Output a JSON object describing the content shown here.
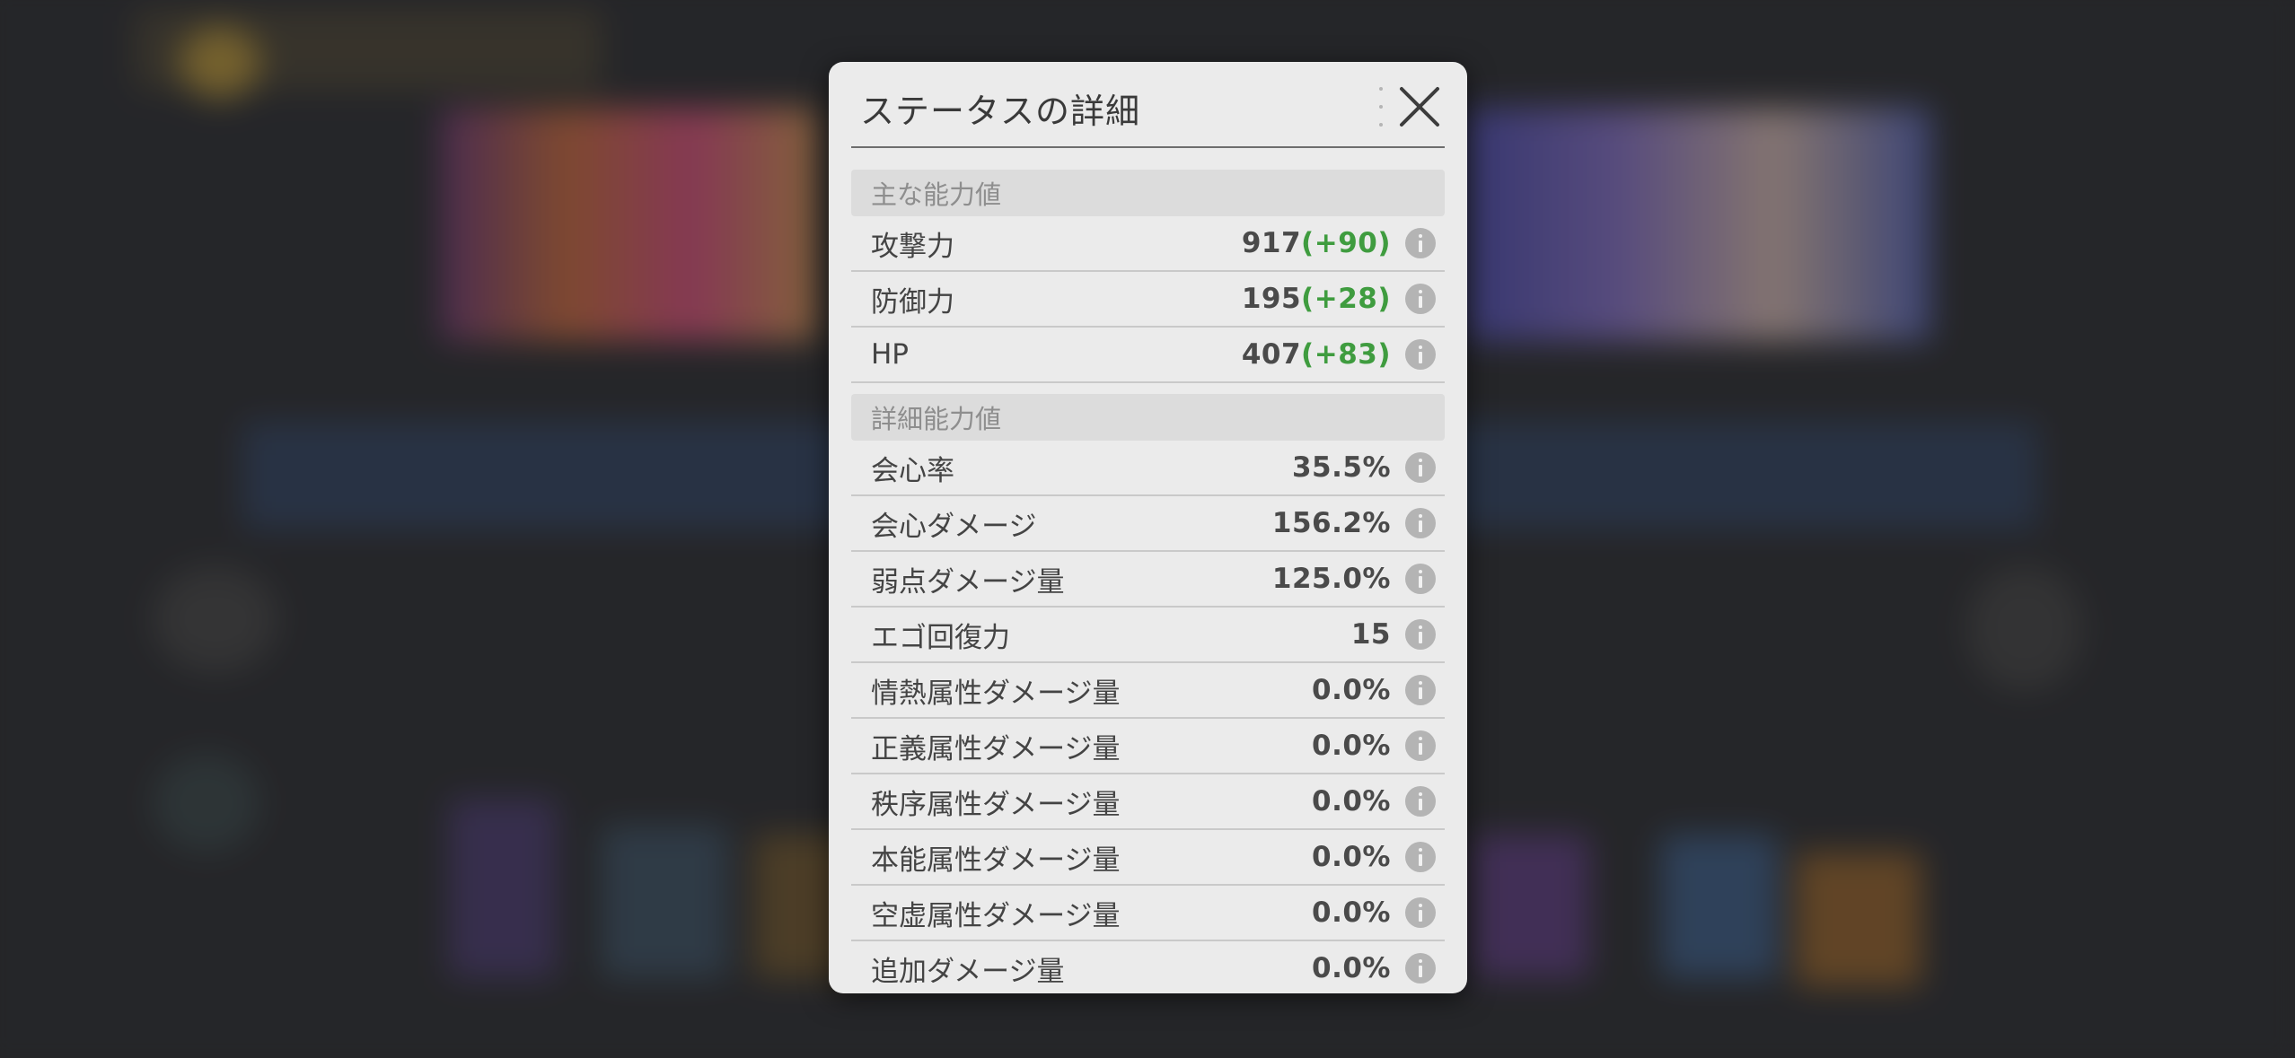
{
  "modal": {
    "title": "ステータスの詳細",
    "sections": [
      {
        "header": "主な能力値",
        "rows": [
          {
            "label": "攻撃力",
            "value": "917",
            "bonus": "(+90)"
          },
          {
            "label": "防御力",
            "value": "195",
            "bonus": "(+28)"
          },
          {
            "label": "HP",
            "value": "407",
            "bonus": "(+83)"
          }
        ]
      },
      {
        "header": "詳細能力値",
        "rows": [
          {
            "label": "会心率",
            "value": "35.5%"
          },
          {
            "label": "会心ダメージ",
            "value": "156.2%"
          },
          {
            "label": "弱点ダメージ量",
            "value": "125.0%"
          },
          {
            "label": "エゴ回復力",
            "value": "15"
          },
          {
            "label": "情熱属性ダメージ量",
            "value": "0.0%"
          },
          {
            "label": "正義属性ダメージ量",
            "value": "0.0%"
          },
          {
            "label": "秩序属性ダメージ量",
            "value": "0.0%"
          },
          {
            "label": "本能属性ダメージ量",
            "value": "0.0%"
          },
          {
            "label": "空虚属性ダメージ量",
            "value": "0.0%"
          },
          {
            "label": "追加ダメージ量",
            "value": "0.0%"
          }
        ]
      }
    ]
  },
  "colors": {
    "bonus_green": "#3f9c3f",
    "panel_bg": "#ebebeb",
    "section_bg": "#dcdcdc"
  },
  "icons": {
    "close": "close-icon",
    "info": "info-icon",
    "drag": "drag-handle-icon"
  }
}
